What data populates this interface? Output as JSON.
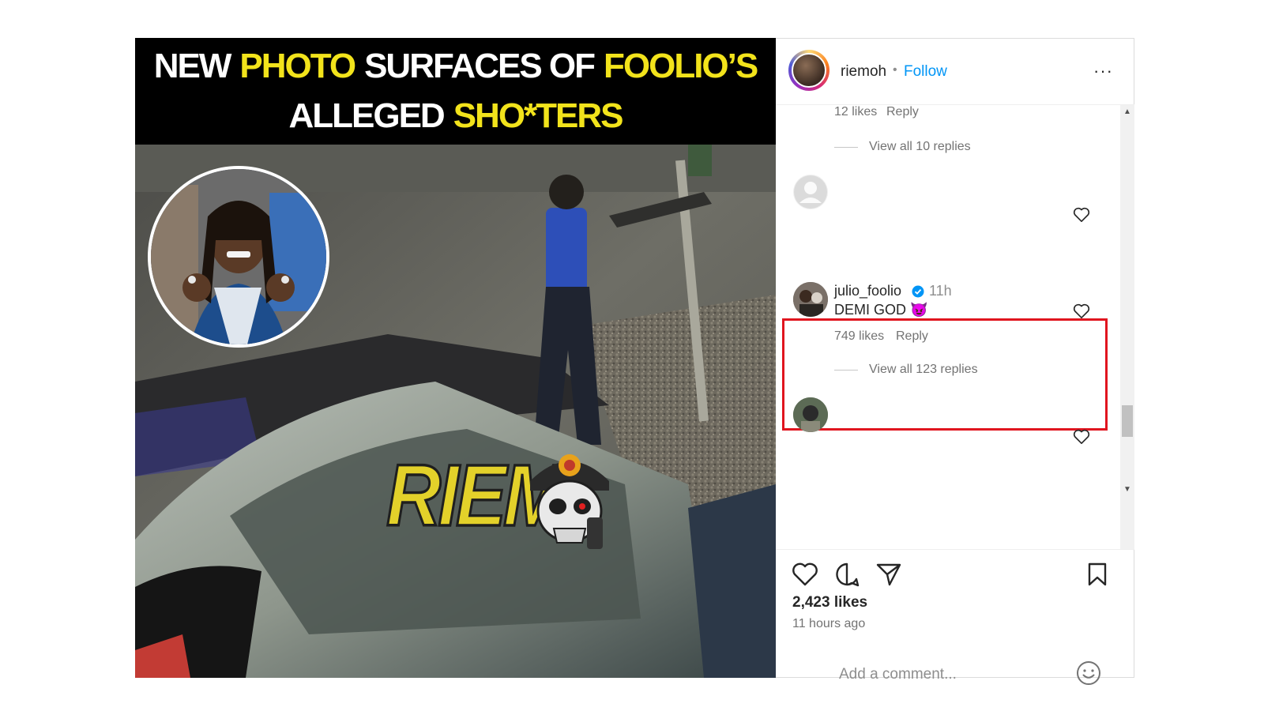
{
  "post": {
    "headline": {
      "line1": [
        {
          "text": "NEW",
          "color": "white"
        },
        {
          "text": "PHOTO",
          "color": "yellow"
        },
        {
          "text": "SURFACES OF",
          "color": "white"
        },
        {
          "text": "FOOLIO’S",
          "color": "yellow"
        }
      ],
      "line2": [
        {
          "text": "ALLEGED",
          "color": "white"
        },
        {
          "text": "SHO*TERS",
          "color": "yellow"
        }
      ]
    },
    "watermark": "RIEM"
  },
  "panel": {
    "username": "riemoh",
    "separator": "•",
    "follow_label": "Follow",
    "more_icon": "···",
    "comments": {
      "top_likes": "12 likes",
      "top_reply": "Reply",
      "top_view_replies": "View all 10 replies",
      "highlighted": {
        "username": "julio_foolio",
        "time": "11h",
        "text": "DEMI GOD 😈",
        "likes": "749 likes",
        "reply": "Reply",
        "view_replies": "View all 123 replies"
      }
    },
    "likes": "2,423 likes",
    "time_ago": "11 hours ago",
    "comment_placeholder": "Add a comment...",
    "icons": [
      "heart-icon",
      "comment-icon",
      "share-icon",
      "bookmark-icon",
      "emoji-icon"
    ],
    "colors": {
      "follow": "#0095f6",
      "highlight_border": "#e0151f",
      "headline_yellow": "#f2e31b"
    }
  }
}
